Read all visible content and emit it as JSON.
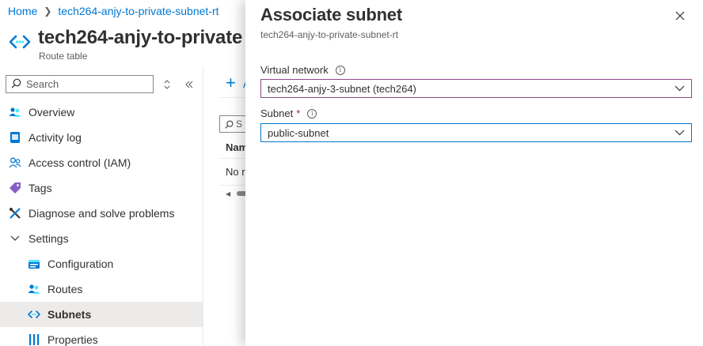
{
  "breadcrumb": {
    "home": "Home",
    "current": "tech264-anjy-to-private-subnet-rt"
  },
  "resource": {
    "title": "tech264-anjy-to-private",
    "type": "Route table",
    "icon": "route-table-icon"
  },
  "sidebar": {
    "search_placeholder": "Search",
    "items": [
      {
        "label": "Overview",
        "icon": "overview-icon"
      },
      {
        "label": "Activity log",
        "icon": "activity-log-icon"
      },
      {
        "label": "Access control (IAM)",
        "icon": "iam-icon"
      },
      {
        "label": "Tags",
        "icon": "tags-icon"
      },
      {
        "label": "Diagnose and solve problems",
        "icon": "diagnose-icon"
      },
      {
        "label": "Settings",
        "icon": "chevron-down-icon"
      },
      {
        "label": "Configuration",
        "icon": "configuration-icon"
      },
      {
        "label": "Routes",
        "icon": "routes-icon"
      },
      {
        "label": "Subnets",
        "icon": "subnets-icon",
        "selected": true
      },
      {
        "label": "Properties",
        "icon": "properties-icon"
      }
    ]
  },
  "content_peek": {
    "add_text": "A",
    "filter_text": "S",
    "column_header": "Nam",
    "empty_cell": "No r"
  },
  "blade": {
    "title": "Associate subnet",
    "subtitle": "tech264-anjy-to-private-subnet-rt",
    "virtual_network": {
      "label": "Virtual network",
      "value": "tech264-anjy-3-subnet (tech264)"
    },
    "subnet": {
      "label": "Subnet",
      "required_marker": "*",
      "value": "public-subnet"
    }
  },
  "colors": {
    "accent": "#0078d4",
    "selected_bg": "#edebe9",
    "required": "#a4262c",
    "vnet_border": "#8a4b8a"
  }
}
